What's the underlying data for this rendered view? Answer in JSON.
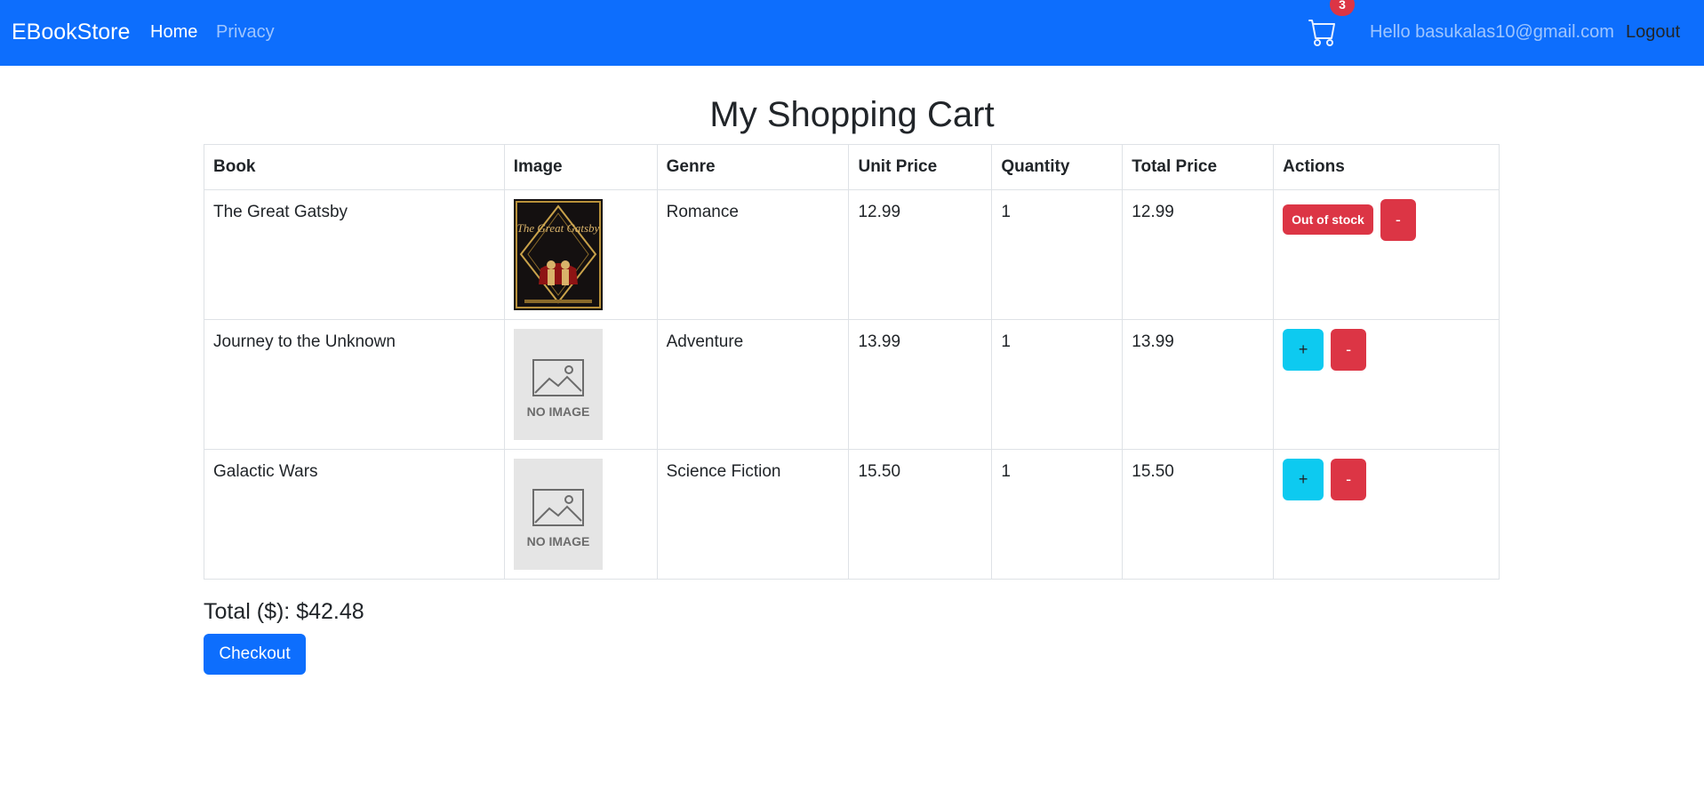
{
  "nav": {
    "brand": "EBookStore",
    "home": "Home",
    "privacy": "Privacy",
    "cart_icon": "cart-icon",
    "cart_count": "3",
    "greeting": "Hello basukalas10@gmail.com",
    "logout": "Logout"
  },
  "page": {
    "title": "My Shopping Cart"
  },
  "table": {
    "headers": [
      "Book",
      "Image",
      "Genre",
      "Unit Price",
      "Quantity",
      "Total Price",
      "Actions"
    ],
    "rows": [
      {
        "book": "The Great Gatsby",
        "image": "cover",
        "image_title": "The Great Gatsby",
        "genre": "Romance",
        "unit_price": "12.99",
        "quantity": "1",
        "total_price": "12.99",
        "out_of_stock": "Out of stock",
        "minus": "-"
      },
      {
        "book": "Journey to the Unknown",
        "image": "no-image",
        "image_text": "NO IMAGE",
        "genre": "Adventure",
        "unit_price": "13.99",
        "quantity": "1",
        "total_price": "13.99",
        "plus": "+",
        "minus": "-"
      },
      {
        "book": "Galactic Wars",
        "image": "no-image",
        "image_text": "NO IMAGE",
        "genre": "Science Fiction",
        "unit_price": "15.50",
        "quantity": "1",
        "total_price": "15.50",
        "plus": "+",
        "minus": "-"
      }
    ]
  },
  "summary": {
    "total": "Total ($): $42.48",
    "checkout": "Checkout"
  },
  "colors": {
    "primary": "#0d6efd",
    "danger": "#dc3545",
    "info": "#0dcaf0"
  }
}
